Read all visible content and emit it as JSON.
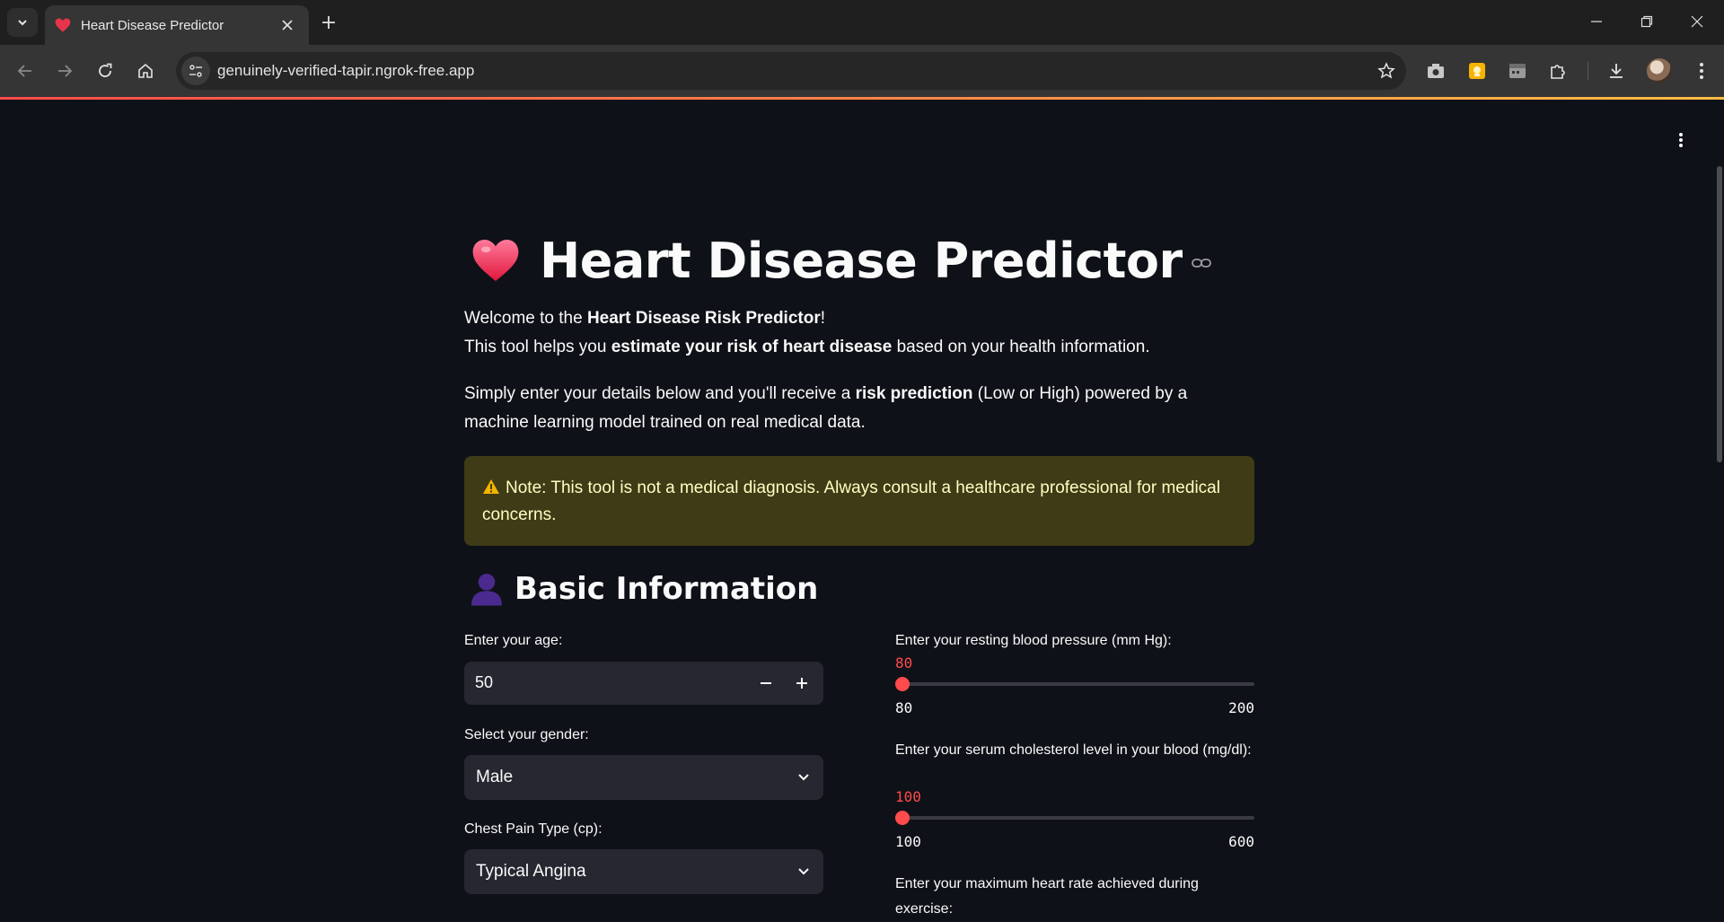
{
  "browser": {
    "tab_title": "Heart Disease Predictor",
    "url": "genuinely-verified-tapir.ngrok-free.app"
  },
  "app": {
    "title": "Heart Disease Predictor",
    "intro": {
      "p1_a": "Welcome to the ",
      "p1_b": "Heart Disease Risk Predictor",
      "p1_c": "!",
      "p2_a": "This tool helps you ",
      "p2_b": "estimate your risk of heart disease",
      "p2_c": " based on your health information.",
      "p3_a": "Simply enter your details below and you'll receive a ",
      "p3_b": "risk prediction",
      "p3_c": " (Low or High) powered by a machine learning model trained on real medical data."
    },
    "alert": "Note: This tool is not a medical diagnosis. Always consult a healthcare professional for medical concerns.",
    "section_title": "Basic Information",
    "age": {
      "label": "Enter your age:",
      "value": "50"
    },
    "gender": {
      "label": "Select your gender:",
      "value": "Male"
    },
    "chest_pain": {
      "label": "Chest Pain Type (cp):",
      "value": "Typical Angina"
    },
    "bp": {
      "label": "Enter your resting blood pressure (mm Hg):",
      "current": "80",
      "min": "80",
      "max": "200",
      "fraction": 0
    },
    "chol": {
      "label": "Enter your serum cholesterol level in your blood (mg/dl):",
      "current": "100",
      "min": "100",
      "max": "600",
      "fraction": 0
    },
    "hr": {
      "label": "Enter your maximum heart rate achieved during exercise:"
    }
  },
  "colors": {
    "accent": "#ff4b4b",
    "background": "#0e1117",
    "alert_bg": "#3e3b16",
    "alert_text": "#ffffc2"
  }
}
